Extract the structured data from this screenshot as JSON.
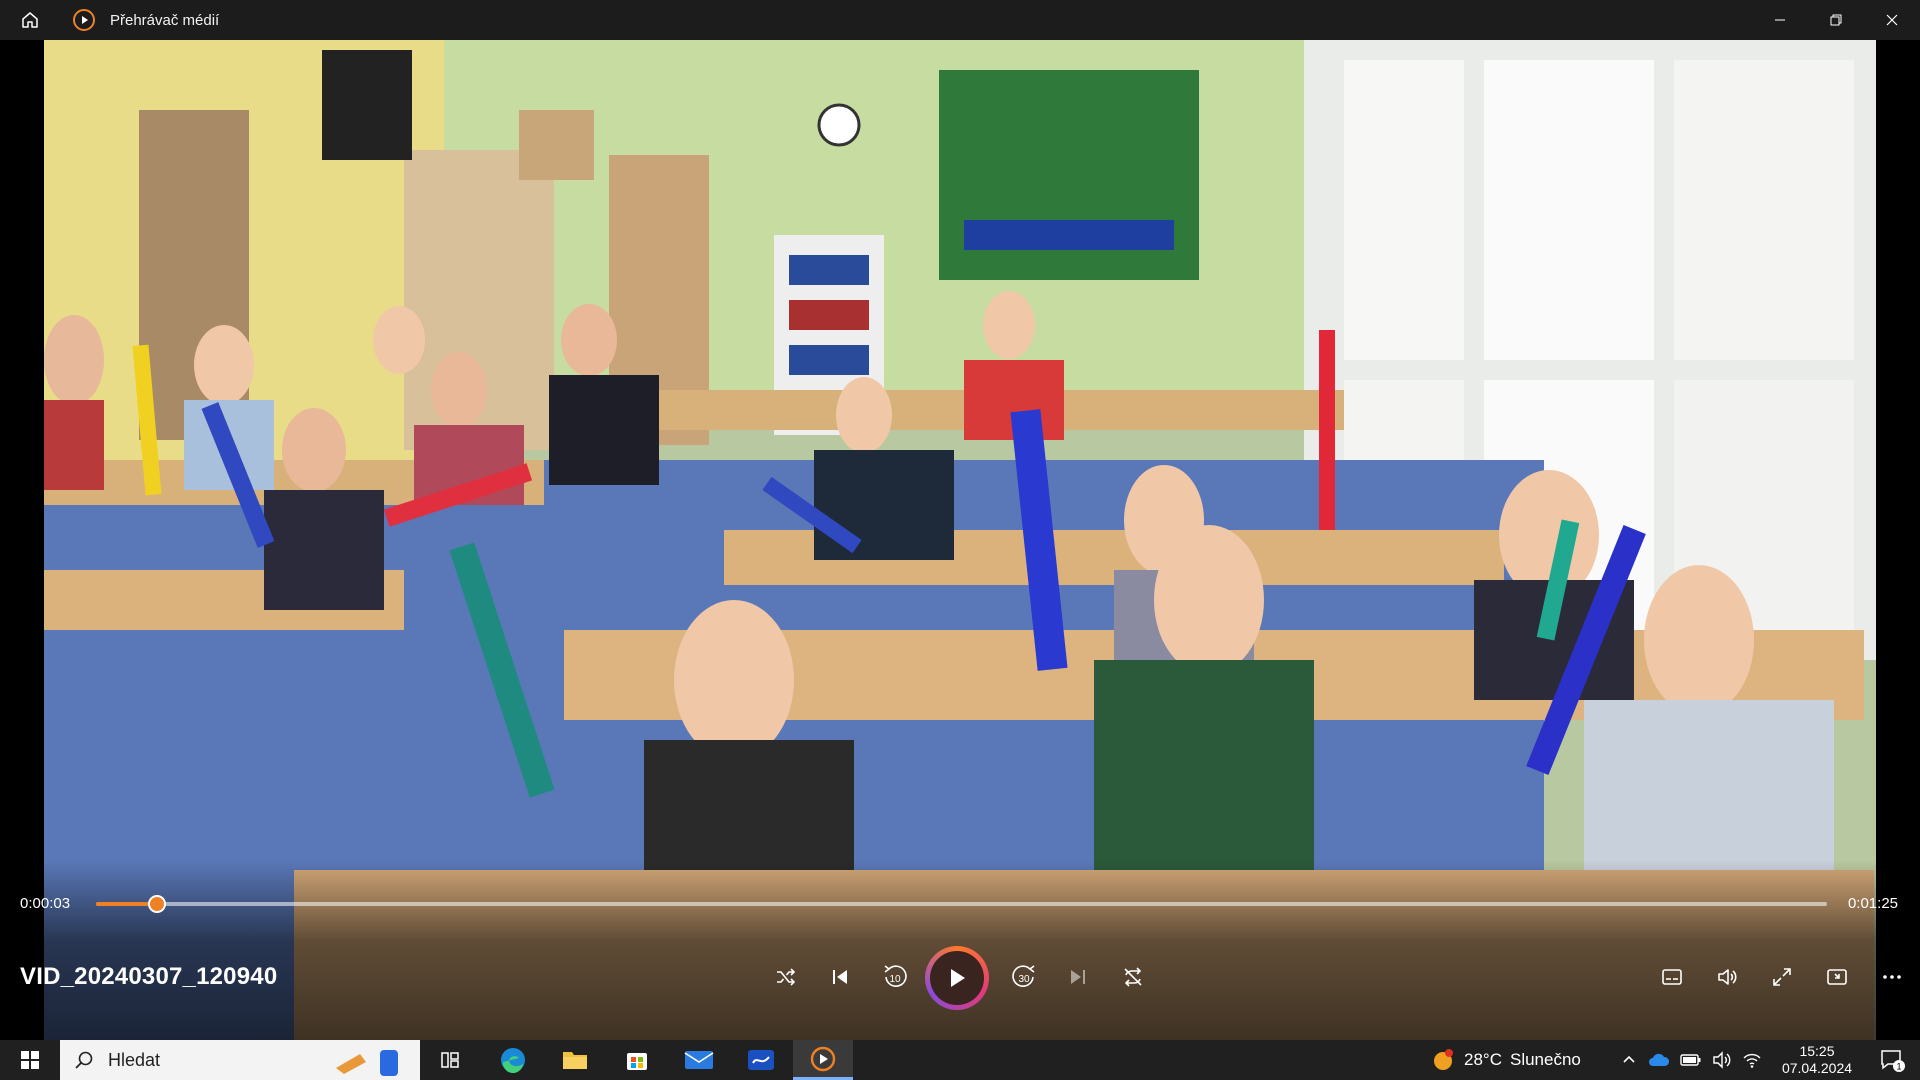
{
  "window": {
    "title": "Přehrávač médií"
  },
  "player": {
    "current_time": "0:00:03",
    "total_time": "0:01:25",
    "progress_fraction": 0.035,
    "file_name": "VID_20240307_120940",
    "accent_color": "#f08024",
    "controls": {
      "shuffle_icon": "shuffle-icon",
      "previous_icon": "previous-icon",
      "back10_label": "10",
      "play_icon": "play-icon",
      "forward30_label": "30",
      "next_icon": "next-icon",
      "repeat_icon": "repeat-off-icon",
      "subtitles_icon": "subtitles-icon",
      "volume_icon": "volume-icon",
      "fullscreen_icon": "fullscreen-icon",
      "miniplayer_icon": "miniplayer-icon",
      "more_icon": "more-icon"
    }
  },
  "taskbar": {
    "search_label": "Hledat",
    "weather_temp": "28°C",
    "weather_text": "Slunečno",
    "time": "15:25",
    "date": "07.04.2024",
    "notification_count": "1"
  }
}
